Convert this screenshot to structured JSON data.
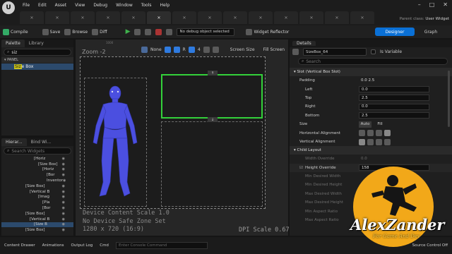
{
  "menu": [
    "File",
    "Edit",
    "Asset",
    "View",
    "Debug",
    "Window",
    "Tools",
    "Help"
  ],
  "tabs": [
    "",
    "",
    "",
    "",
    "",
    "",
    "",
    "",
    "",
    "",
    "",
    "",
    "",
    ""
  ],
  "parent_class": {
    "label": "Parent class:",
    "value": "User Widget"
  },
  "toolbar": {
    "compile": "Compile",
    "save": "Save",
    "browse": "Browse",
    "diff": "Diff",
    "debug_object": "No debug object selected",
    "widget_reflector": "Widget Reflector",
    "designer": "Designer",
    "graph": "Graph"
  },
  "palette": {
    "tab1": "Palette",
    "tab2": "Library",
    "search_value": "siz",
    "section": "PANEL",
    "item_hl": "Siz",
    "item_rest": "e Box"
  },
  "hierarchy": {
    "tab1": "Hierar...",
    "tab2": "Bind Wi...",
    "search_placeholder": "Search Widgets",
    "rows": [
      {
        "indent": 46,
        "label": "[Horiz"
      },
      {
        "indent": 52,
        "label": "[Size Box]"
      },
      {
        "indent": 58,
        "label": "[Horiz"
      },
      {
        "indent": 64,
        "label": "[Bor"
      },
      {
        "indent": 64,
        "label": "Inventor"
      },
      {
        "indent": 34,
        "label": "[Size Box]"
      },
      {
        "indent": 40,
        "label": "[Vertical B"
      },
      {
        "indent": 52,
        "label": "[Imag"
      },
      {
        "indent": 58,
        "label": "[Pla"
      },
      {
        "indent": 58,
        "label": "[Bor"
      },
      {
        "indent": 34,
        "label": "[Size Box]"
      },
      {
        "indent": 40,
        "label": "[Vertical B"
      },
      {
        "indent": 46,
        "label": "[Size B"
      },
      {
        "indent": 34,
        "label": "[Size Box]"
      }
    ]
  },
  "designer": {
    "zoom": "Zoom -2",
    "none_label": "None",
    "r_label": "R",
    "grid_value": "4",
    "screen_size": "Screen Size",
    "fill_screen": "Fill Screen",
    "scale_lines": [
      "Device Content Scale 1.0",
      "No Device Safe Zone Set",
      "1280 x 720 (16:9)"
    ],
    "dpi": "DPI Scale 0.67",
    "ruler_label": "1000"
  },
  "details": {
    "title": "Details",
    "widget_name": "SizeBox_64",
    "is_variable": "Is Variable",
    "search_placeholder": "Search",
    "slot_section": "Slot (Vertical Box Slot)",
    "padding_label": "Padding",
    "padding_value": "0.0 2.5",
    "left_label": "Left",
    "left_value": "0.0",
    "top_label": "Top",
    "top_value": "2.5",
    "right_label": "Right",
    "right_value": "0.0",
    "bottom_label": "Bottom",
    "bottom_value": "2.5",
    "size_label": "Size",
    "size_auto": "Auto",
    "size_fill": "Fill",
    "halign_label": "Horizontal Alignment",
    "valign_label": "Vertical Alignment",
    "child_section": "Child Layout",
    "width_override": "Width Override",
    "width_override_value": "0.0",
    "height_override": "Height Override",
    "height_override_value": "158",
    "min_desired_width": "Min Desired Width",
    "min_desired_height": "Min Desired Height",
    "max_desired_width": "Max Desired Width",
    "max_desired_height": "Max Desired Height",
    "min_aspect_ratio": "Min Aspect Ratio",
    "max_aspect_ratio": "Max Aspect Ratio"
  },
  "bottom": {
    "content_drawer": "Content Drawer",
    "animations": "Animations",
    "output_log": "Output Log",
    "cmd": "Cmd",
    "cmd_placeholder": "Enter Console Command",
    "source_control": "Source Control Off"
  },
  "watermark": {
    "line1": "AlexZander",
    "line2": "For Game And Dev"
  },
  "colors": {
    "accent": "#0a70d6",
    "selection": "#33d13a",
    "mannequin": "#4b4fe0",
    "watermark_bg": "#f2a819"
  }
}
